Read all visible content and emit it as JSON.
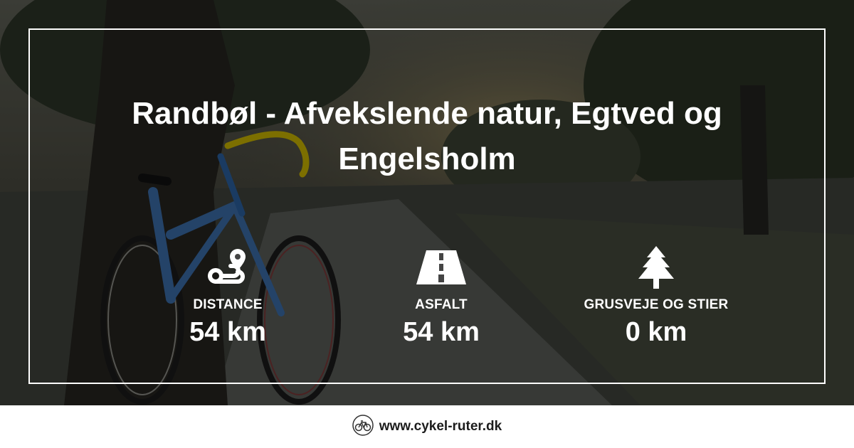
{
  "route": {
    "title_line1": "Randbøl - Afvekslende natur, Egtved og",
    "title_line2": "Engelsholm"
  },
  "stats": [
    {
      "icon": "route-icon",
      "label": "DISTANCE",
      "value": "54 km"
    },
    {
      "icon": "road-icon",
      "label": "ASFALT",
      "value": "54 km"
    },
    {
      "icon": "tree-icon",
      "label": "GRUSVEJE OG STIER",
      "value": "0 km"
    }
  ],
  "footer": {
    "icon": "bicycle-logo-icon",
    "site": "www.cykel-ruter.dk"
  },
  "colors": {
    "text": "#ffffff",
    "overlay": "#000000",
    "footer_bg": "#ffffff",
    "footer_text": "#1c1c1c"
  }
}
